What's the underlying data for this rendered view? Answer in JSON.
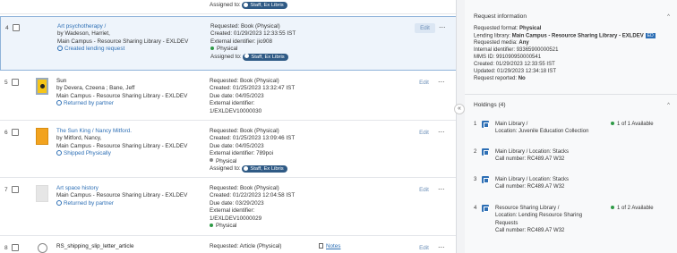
{
  "list": {
    "top_assigned": "Assigned to:",
    "top_assigned_chip": "Staff, Ex Libris",
    "rows": [
      {
        "num": "4",
        "title": "Art psychotherapy /",
        "author": "by Wadeson, Harriet,",
        "library": "Main Campus - Resource Sharing Library - EXLDEV",
        "status": "Created lending request",
        "requested": "Requested: Book (Physical)",
        "created": "Created: 01/29/2023 12:33:55 IST",
        "external": "External identifier: jio908",
        "format": "Physical",
        "assigned": "Assigned to:",
        "chip": "Staff, Ex Libris",
        "edit": "Edit",
        "more": "···"
      },
      {
        "num": "5",
        "title": "Sun",
        "author": "by Devera, Czeena ; Bane, Jeff",
        "library": "Main Campus - Resource Sharing Library - EXLDEV",
        "status": "Returned by partner",
        "requested": "Requested: Book (Physical)",
        "created": "Created: 01/25/2023 13:32:47 IST",
        "due": "Due date: 04/05/2023",
        "external": "External identifier:",
        "external2": "1/EXLDEV10000030",
        "edit": "Edit",
        "more": "···"
      },
      {
        "num": "6",
        "title": "The Sun King / Nancy Mitford.",
        "author": "by Mitford, Nancy,",
        "library": "Main Campus - Resource Sharing Library - EXLDEV",
        "status": "Shipped Physically",
        "requested": "Requested: Book (Physical)",
        "created": "Created: 01/25/2023 13:09:46 IST",
        "due": "Due date: 04/05/2023",
        "external": "External identifier: 789poi",
        "format": "Physical",
        "assigned": "Assigned to:",
        "chip": "Staff, Ex Libris",
        "edit": "Edit",
        "more": "···"
      },
      {
        "num": "7",
        "title": "Art space history",
        "library": "Main Campus - Resource Sharing Library - EXLDEV",
        "status": "Returned by partner",
        "requested": "Requested: Book (Physical)",
        "created": "Created: 01/22/2023 12:04:58 IST",
        "due": "Due date: 03/29/2023",
        "external": "External identifier:",
        "external2": "1/EXLDEV10000029",
        "format": "Physical",
        "edit": "Edit",
        "more": "···"
      },
      {
        "num": "8",
        "title": "RS_shipping_slip_letter_article",
        "requested": "Requested: Article (Physical)",
        "notes": "Notes",
        "edit": "Edit",
        "more": "···"
      }
    ]
  },
  "collapse_icon": "«",
  "request_info": {
    "header": "Request information",
    "caret": "^",
    "lines": [
      {
        "label": "Requested format: ",
        "value": "Physical"
      },
      {
        "label": "Lending library: ",
        "value": "Main Campus - Resource Sharing Library - EXLDEV"
      },
      {
        "label": "Requested media: ",
        "value": "Any"
      },
      {
        "label": "Internal identifier: ",
        "value": "93365900000521"
      },
      {
        "label": "MMS ID: ",
        "value": "991090950000541"
      },
      {
        "label": "Created: ",
        "value": "01/29/2023 12:33:55 IST"
      },
      {
        "label": "Updated: ",
        "value": "01/29/2023 12:34:18 IST"
      },
      {
        "label": "Request reported: ",
        "value": "No"
      }
    ],
    "lending_badge": "ED"
  },
  "holdings": {
    "header": "Holdings (4)",
    "caret": "^",
    "items": [
      {
        "num": "1",
        "name": "Main Library /",
        "location": "Location: Juvenile Education Collection",
        "avail": "1 of 1 Available"
      },
      {
        "num": "2",
        "name": "Main Library / Location: Stacks",
        "call": "Call number: RC489.A7 W32"
      },
      {
        "num": "3",
        "name": "Main Library / Location: Stacks",
        "call": "Call number: RC489.A7 W32"
      },
      {
        "num": "4",
        "name": "Resource Sharing Library /",
        "location": "Location: Lending Resource Sharing",
        "location2": "Requests",
        "call": "Call number: RC489.A7 W32",
        "avail": "1 of 2 Available"
      }
    ]
  },
  "colors": {
    "accent": "#2d6fb5",
    "chip": "#2f5a85",
    "available": "#2e9a46"
  }
}
